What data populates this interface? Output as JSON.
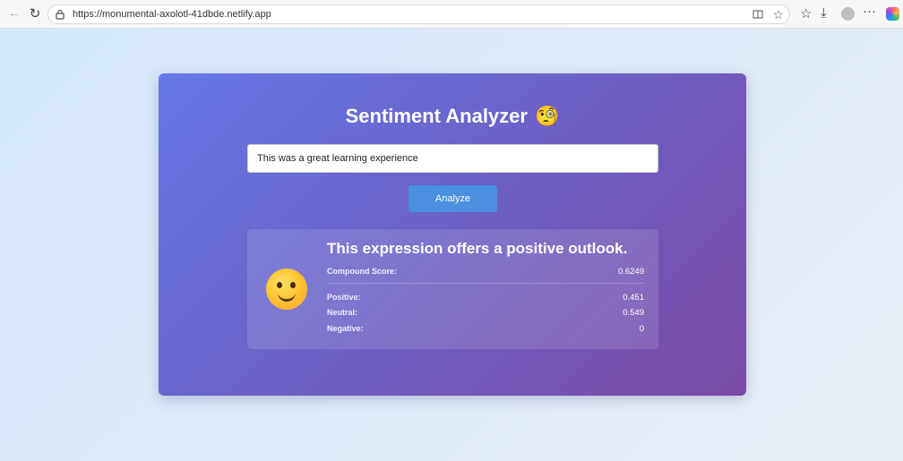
{
  "browser": {
    "url": "https://monumental-axolotl-41dbde.netlify.app",
    "icons": [
      "back-icon",
      "reload-icon",
      "site-info-icon",
      "split-screen-icon",
      "favorite-star-icon",
      "favorites-icon",
      "downloads-icon",
      "profile-avatar",
      "more-icon",
      "copilot-icon"
    ]
  },
  "app": {
    "title": "Sentiment Analyzer",
    "title_emoji": "🧐",
    "input_value": "This was a great learning experience",
    "analyze_label": "Analyze",
    "result": {
      "emoji": "smiling-face",
      "verdict": "This expression offers a positive outlook.",
      "compound_label": "Compound Score:",
      "compound_value": "0.6249",
      "positive_label": "Positive:",
      "positive_value": "0.451",
      "neutral_label": "Neutral:",
      "neutral_value": "0.549",
      "negative_label": "Negative:",
      "negative_value": "0"
    }
  },
  "colors": {
    "card_start": "#6478e6",
    "card_end": "#7a4aa6",
    "button": "#4a8fe0"
  }
}
